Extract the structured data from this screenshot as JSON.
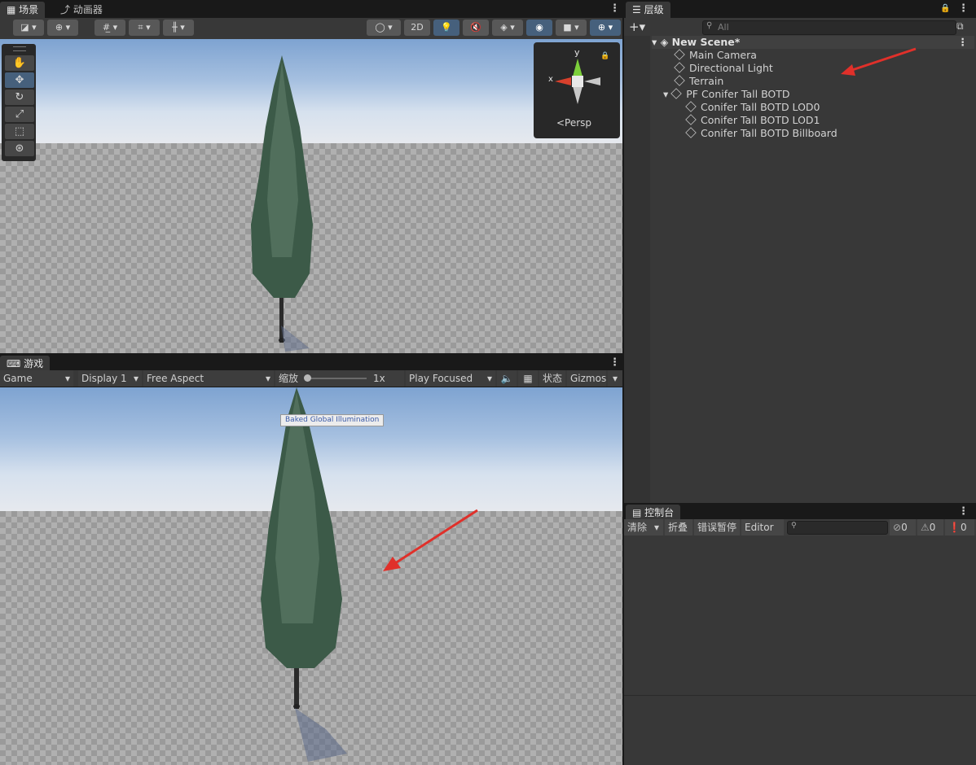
{
  "scene_tabs": {
    "scene_label": "场景",
    "animator_label": "动画器"
  },
  "scene_toolbar": {
    "button_2d": "2D"
  },
  "gizmo": {
    "y_label": "y",
    "x_label": "x",
    "persp_label": "<Persp"
  },
  "game_tab": {
    "label": "游戏"
  },
  "game_toolbar": {
    "view_select": "Game",
    "display_select": "Display 1",
    "aspect_select": "Free Aspect",
    "zoom_label": "缩放",
    "zoom_value": "1x",
    "play_mode_select": "Play Focused",
    "stats_label": "状态",
    "gizmos_label": "Gizmos"
  },
  "game_view": {
    "tooltip": "Baked Global Illumination"
  },
  "hierarchy": {
    "tab_label": "层级",
    "search_placeholder": "All",
    "scene_name": "New Scene*",
    "items": [
      {
        "label": "Main Camera"
      },
      {
        "label": "Directional Light"
      },
      {
        "label": "Terrain"
      },
      {
        "label": "PF Conifer Tall BOTD"
      },
      {
        "label": "Conifer Tall BOTD LOD0"
      },
      {
        "label": "Conifer Tall BOTD LOD1"
      },
      {
        "label": "Conifer Tall BOTD Billboard"
      }
    ]
  },
  "console": {
    "tab_label": "控制台",
    "clear_label": "清除",
    "collapse_label": "折叠",
    "error_pause_label": "错误暂停",
    "editor_select": "Editor",
    "error_count": "0",
    "warning_count": "0",
    "info_count": "0"
  },
  "colors": {
    "accent_blue": "#46607c",
    "annotation_red": "#e0302a"
  }
}
